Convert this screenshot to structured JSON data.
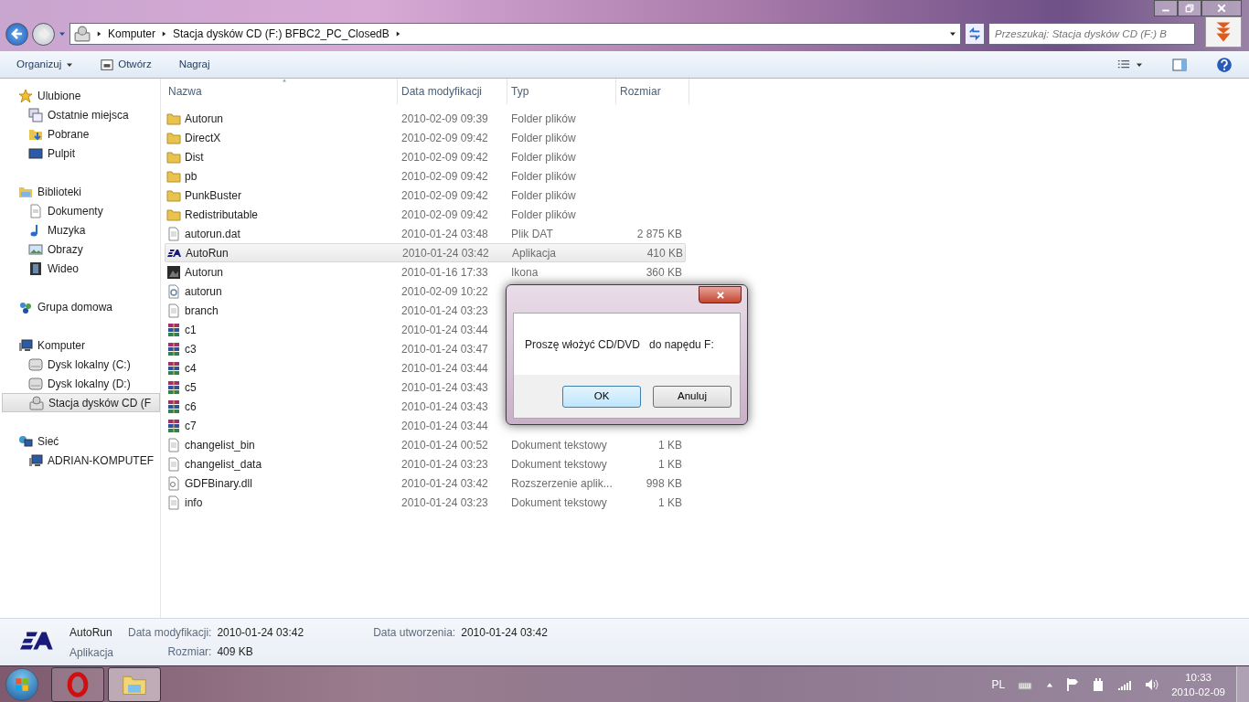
{
  "address": {
    "crumbs": [
      "Komputer",
      "Stacja dysków CD (F:) BFBC2_PC_ClosedB"
    ]
  },
  "search": {
    "placeholder": "Przeszukaj: Stacja dysków CD (F:) B"
  },
  "toolbar": [
    {
      "label": "Organizuj",
      "kind": "menu"
    },
    {
      "label": "Otwórz",
      "kind": "open"
    },
    {
      "label": "Nagraj",
      "kind": "plain"
    }
  ],
  "sidebar": [
    {
      "label": "Ulubione",
      "kind": "star",
      "selected": false,
      "children": [
        {
          "label": "Ostatnie miejsca",
          "kind": "recent",
          "selected": false
        },
        {
          "label": "Pobrane",
          "kind": "download",
          "selected": false
        },
        {
          "label": "Pulpit",
          "kind": "desktop",
          "selected": false
        }
      ]
    },
    {
      "label": "Biblioteki",
      "kind": "library",
      "selected": false,
      "children": [
        {
          "label": "Dokumenty",
          "kind": "document",
          "selected": false
        },
        {
          "label": "Muzyka",
          "kind": "music",
          "selected": false
        },
        {
          "label": "Obrazy",
          "kind": "picture",
          "selected": false
        },
        {
          "label": "Wideo",
          "kind": "video",
          "selected": false
        }
      ]
    },
    {
      "label": "Grupa domowa",
      "kind": "homegroup",
      "selected": false
    },
    {
      "label": "Komputer",
      "kind": "computer",
      "selected": false,
      "children": [
        {
          "label": "Dysk lokalny (C:)",
          "kind": "drive",
          "selected": false
        },
        {
          "label": "Dysk lokalny (D:)",
          "kind": "drive",
          "selected": false
        },
        {
          "label": "Stacja dysków CD (F",
          "kind": "cd",
          "selected": true
        }
      ]
    },
    {
      "label": "Sieć",
      "kind": "network",
      "selected": false,
      "children": [
        {
          "label": "ADRIAN-KOMPUTEF",
          "kind": "computer",
          "selected": false
        }
      ]
    }
  ],
  "columns": [
    {
      "label": "Nazwa",
      "sorted": true
    },
    {
      "label": "Data modyfikacji",
      "sorted": false
    },
    {
      "label": "Typ",
      "sorted": false
    },
    {
      "label": "Rozmiar",
      "sorted": false
    }
  ],
  "rows": [
    {
      "name": "Autorun",
      "kind": "folder",
      "date": "2010-02-09 09:39",
      "type": "Folder plików",
      "selected": false
    },
    {
      "name": "DirectX",
      "kind": "folder",
      "date": "2010-02-09 09:42",
      "type": "Folder plików",
      "selected": false
    },
    {
      "name": "Dist",
      "kind": "folder",
      "date": "2010-02-09 09:42",
      "type": "Folder plików",
      "selected": false
    },
    {
      "name": "pb",
      "kind": "folder",
      "date": "2010-02-09 09:42",
      "type": "Folder plików",
      "selected": false
    },
    {
      "name": "PunkBuster",
      "kind": "folder",
      "date": "2010-02-09 09:42",
      "type": "Folder plików",
      "selected": false
    },
    {
      "name": "Redistributable",
      "kind": "folder",
      "date": "2010-02-09 09:42",
      "type": "Folder plików",
      "selected": false
    },
    {
      "name": "autorun.dat",
      "kind": "file",
      "date": "2010-01-24 03:48",
      "type": "Plik DAT",
      "size": "2 875 KB",
      "selected": false
    },
    {
      "name": "AutoRun",
      "kind": "ea",
      "date": "2010-01-24 03:42",
      "type": "Aplikacja",
      "size": "410 KB",
      "selected": true
    },
    {
      "name": "Autorun",
      "kind": "image",
      "date": "2010-01-16 17:33",
      "type": "Ikona",
      "size": "360 KB",
      "selected": false
    },
    {
      "name": "autorun",
      "kind": "settings",
      "date": "2010-02-09 10:22",
      "selected": false
    },
    {
      "name": "branch",
      "kind": "file",
      "date": "2010-01-24 03:23",
      "selected": false
    },
    {
      "name": "c1",
      "kind": "archive",
      "date": "2010-01-24 03:44",
      "selected": false
    },
    {
      "name": "c3",
      "kind": "archive",
      "date": "2010-01-24 03:47",
      "selected": false
    },
    {
      "name": "c4",
      "kind": "archive",
      "date": "2010-01-24 03:44",
      "selected": false
    },
    {
      "name": "c5",
      "kind": "archive",
      "date": "2010-01-24 03:43",
      "selected": false
    },
    {
      "name": "c6",
      "kind": "archive",
      "date": "2010-01-24 03:43",
      "selected": false
    },
    {
      "name": "c7",
      "kind": "archive",
      "date": "2010-01-24 03:44",
      "selected": false
    },
    {
      "name": "changelist_bin",
      "kind": "file",
      "date": "2010-01-24 00:52",
      "type": "Dokument tekstowy",
      "size": "1 KB",
      "selected": false
    },
    {
      "name": "changelist_data",
      "kind": "file",
      "date": "2010-01-24 03:23",
      "type": "Dokument tekstowy",
      "size": "1 KB",
      "selected": false
    },
    {
      "name": "GDFBinary.dll",
      "kind": "dll",
      "date": "2010-01-24 03:42",
      "type": "Rozszerzenie aplik...",
      "size": "998 KB",
      "selected": false
    },
    {
      "name": "info",
      "kind": "file",
      "date": "2010-01-24 03:23",
      "type": "Dokument tekstowy",
      "size": "1 KB",
      "selected": false
    }
  ],
  "details": {
    "name": "AutoRun",
    "type": "Aplikacja",
    "columns": [
      [
        {
          "label": "Data modyfikacji:",
          "value": "2010-01-24 03:42"
        },
        {
          "label": "Rozmiar:",
          "value": "409 KB"
        }
      ],
      [
        {
          "label": "Data utworzenia:",
          "value": "2010-01-24 03:42"
        }
      ]
    ]
  },
  "dialog": {
    "message": "Proszę włożyć CD/DVD   do napędu F:",
    "buttons": [
      {
        "label": "OK",
        "default": true
      },
      {
        "label": "Anuluj",
        "default": false
      }
    ]
  },
  "taskbar": {
    "apps": [
      {
        "kind": "opera",
        "active": false
      },
      {
        "kind": "explorer",
        "active": true
      }
    ],
    "language": "PL",
    "time": "10:33",
    "date": "2010-02-09"
  }
}
